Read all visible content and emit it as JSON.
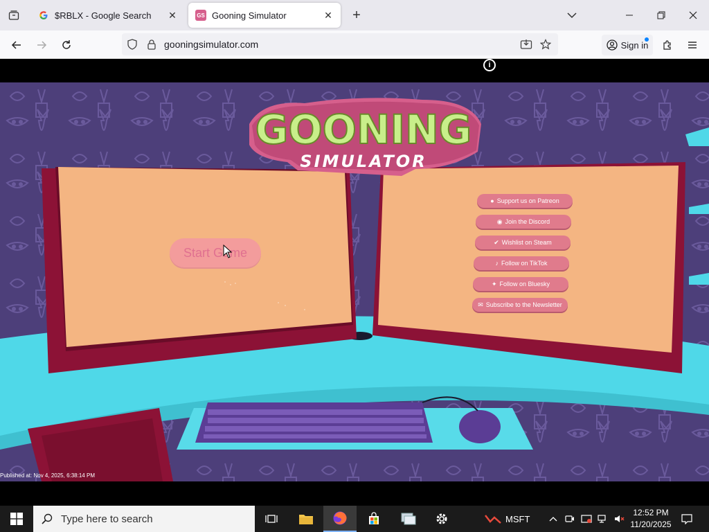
{
  "browser": {
    "tabs": [
      {
        "title": "$RBLX - Google Search",
        "icon": "google-icon"
      },
      {
        "title": "Gooning Simulator",
        "icon": "gs-favicon-icon",
        "favicon_text": "GS"
      }
    ],
    "url": "gooningsimulator.com",
    "sign_in_label": "Sign in"
  },
  "page": {
    "logo": {
      "line1": "GOONING",
      "line2": "SIMULATOR"
    },
    "start_button_label": "Start Game",
    "links": [
      {
        "label": "Support us on Patreon",
        "icon": "patreon-icon"
      },
      {
        "label": "Join the Discord",
        "icon": "discord-icon"
      },
      {
        "label": "Wishlist on Steam",
        "icon": "steam-icon"
      },
      {
        "label": "Follow on TikTok",
        "icon": "tiktok-icon"
      },
      {
        "label": "Follow on Bluesky",
        "icon": "bluesky-icon"
      },
      {
        "label": "Subscribe to the Newsletter",
        "icon": "newsletter-icon"
      }
    ],
    "published": "Published at: Nov 4, 2025, 6:38:14 PM",
    "info_icon_text": "i"
  },
  "taskbar": {
    "search_placeholder": "Type here to search",
    "stock_label": "MSFT",
    "time": "12:52 PM",
    "date": "11/20/2025"
  },
  "colors": {
    "wallpaper": "#4d3f7a",
    "desk": "#4fd8e8",
    "monitor_frame": "#8c1236",
    "monitor_screen": "#f4b582",
    "button_pink": "#e07b8c",
    "logo_green": "#c8ef8a",
    "logo_pink": "#d65f8c"
  }
}
